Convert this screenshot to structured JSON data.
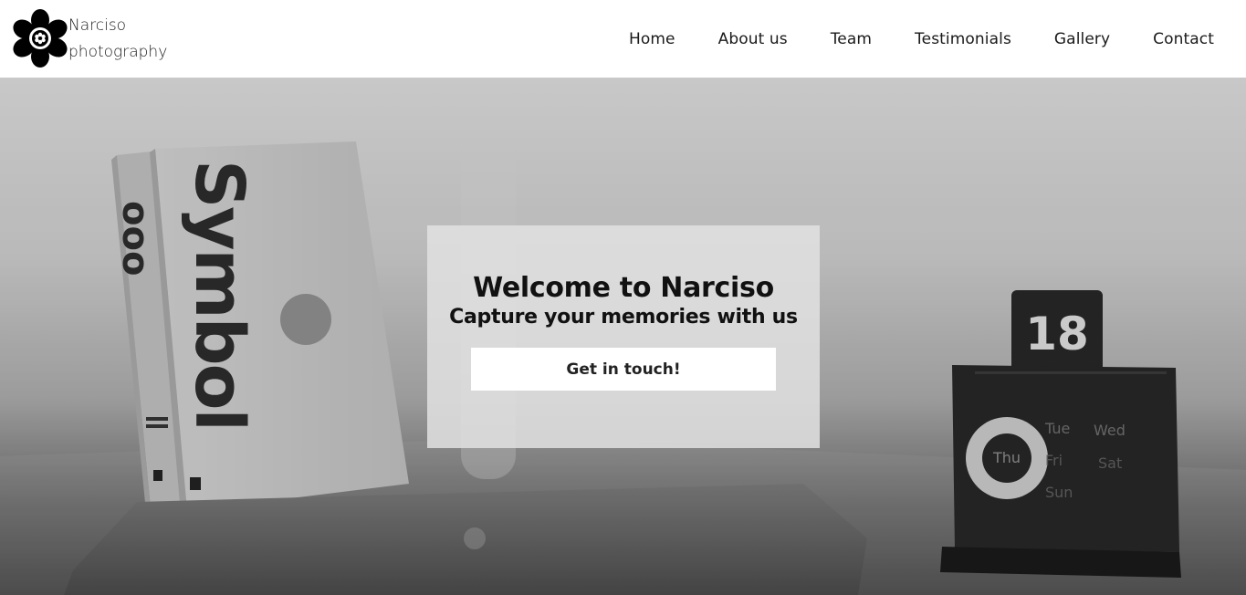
{
  "brand": {
    "name_line1": "Narciso",
    "name_line2": "photography",
    "logo_icon": "flower-logo-icon"
  },
  "nav": {
    "items": [
      {
        "label": "Home"
      },
      {
        "label": "About us"
      },
      {
        "label": "Team"
      },
      {
        "label": "Testimonials"
      },
      {
        "label": "Gallery"
      },
      {
        "label": "Contact"
      }
    ]
  },
  "hero": {
    "title": "Welcome to Narciso",
    "subtitle": "Capture your memories with us",
    "cta_label": "Get in touch!",
    "background": {
      "book_spine_text": "Symbol",
      "calendar_date": "18",
      "calendar_days": [
        "Tue",
        "Wed",
        "Thu",
        "Fri",
        "Sat",
        "Sun"
      ]
    }
  },
  "colors": {
    "header_bg": "#ffffff",
    "text": "#1a1a1a",
    "card_bg": "#e1e1e1",
    "button_bg": "#ffffff"
  }
}
